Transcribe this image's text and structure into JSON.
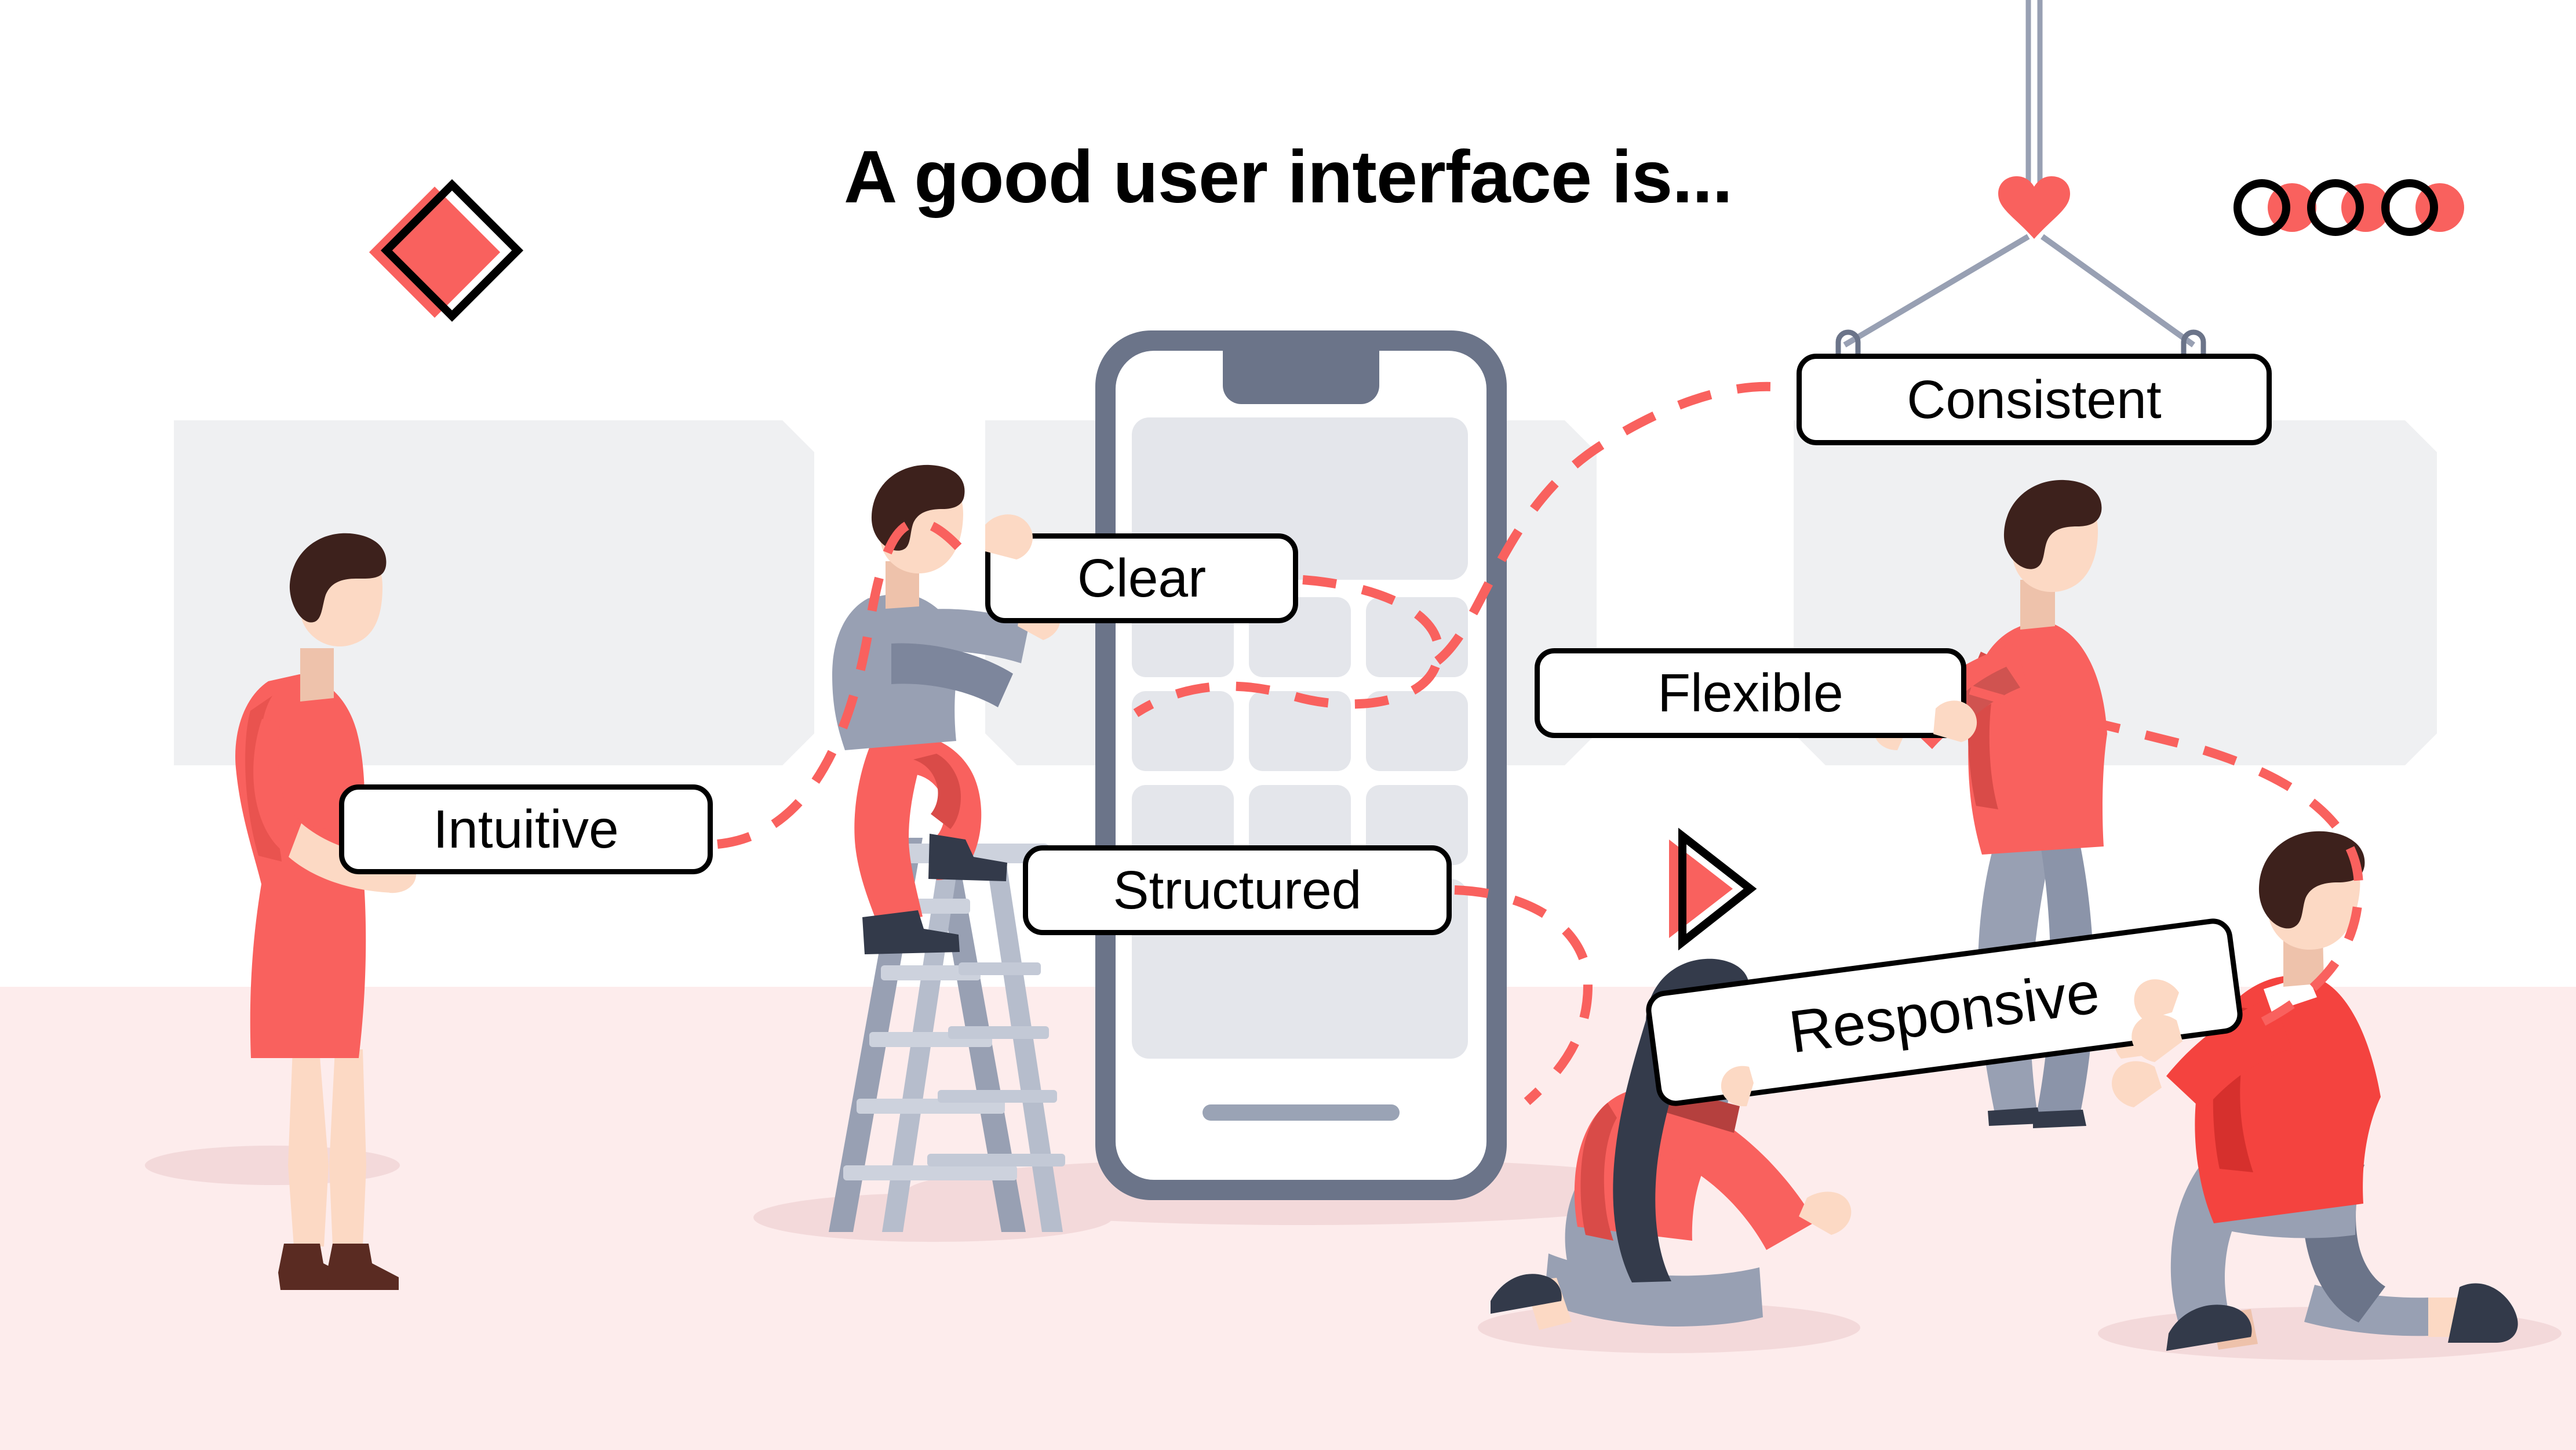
{
  "page": {
    "title": "A good user interface is...",
    "background_color": "#ffffff",
    "floor_color": "#fdecec",
    "panel_color": "#eff0f2",
    "accent_coral": "#f9615e",
    "accent_coral_soft": "#fa6d6a",
    "ink": "#000000",
    "slate": "#6b7489",
    "slate_light": "#98a0b3",
    "screen_tile": "#e4e6eb",
    "skin": "#fcd9c4",
    "hair_dark_brown": "#3d211c",
    "hair_black": "#343b4b",
    "shoe_navy": "#333a4a",
    "shoe_brown": "#5a2b22"
  },
  "labels": {
    "intuitive": "Intuitive",
    "clear": "Clear",
    "structured": "Structured",
    "flexible": "Flexible",
    "consistent": "Consistent",
    "responsive": "Responsive"
  },
  "decorations": {
    "diamond_pair": "diamond-pair",
    "triangle_pair": "triangle-pair",
    "circle_pairs_count": 3,
    "crane_hook": "crane-hook",
    "dashed_connector": "dashed-path"
  },
  "phone": {
    "frame_color": "#6b7489",
    "screen_color": "#ffffff",
    "tile_color": "#e4e6eb",
    "notch": "notch",
    "home_indicator": "home-indicator",
    "tile_grid_rows": 3,
    "tile_grid_cols": 3
  },
  "characters": [
    {
      "name": "woman-standing",
      "outfit": "coral-dress",
      "holds": "Intuitive"
    },
    {
      "name": "man-on-ladder",
      "outfit": "gray-top-coral-pants",
      "holds": "Clear"
    },
    {
      "name": "man-standing-right",
      "outfit": "coral-top-gray-pants",
      "holds": "Flexible"
    },
    {
      "name": "woman-kneeling",
      "outfit": "coral-top-gray-pants",
      "holds": "Responsive"
    },
    {
      "name": "man-kneeling",
      "outfit": "coral-top-gray-pants",
      "holds": "Responsive"
    }
  ]
}
